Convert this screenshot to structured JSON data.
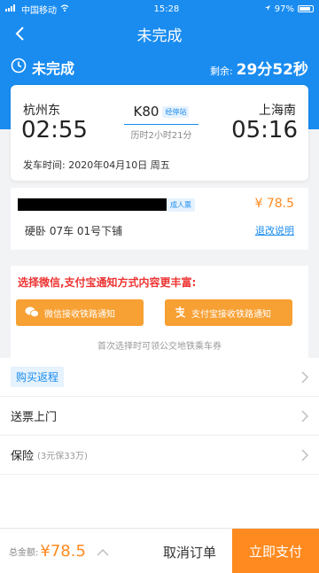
{
  "statusbar": {
    "carrier": "中国移动",
    "time": "15:28",
    "battery": "97%"
  },
  "nav": {
    "title": "未完成"
  },
  "status": {
    "label": "未完成",
    "remaining_label": "剩余:",
    "remaining_value": "29分52秒"
  },
  "trip": {
    "from_station": "杭州东",
    "from_time": "02:55",
    "to_station": "上海南",
    "to_time": "05:16",
    "train_no": "K80",
    "train_tag": "经停站",
    "duration": "历时2小时21分",
    "depart_label": "发车时间:",
    "depart_date": "2020年04月10日 周五"
  },
  "passenger": {
    "tag": "成人票",
    "price": "¥ 78.5",
    "seat": "硬卧 07车 01号下铺",
    "refund_link": "退改说明"
  },
  "notice": {
    "title": "选择微信,支付宝通知方式内容更丰富:",
    "wechat_btn": "微信接收铁路通知",
    "alipay_btn": "支付宝接收铁路通知",
    "footnote": "首次选择时可领公交地铁乘车券"
  },
  "list": {
    "return_ticket": "购买返程",
    "delivery": "送票上门",
    "insurance": "保险",
    "insurance_sub": "(3元保33万)"
  },
  "bottom": {
    "total_label": "总金额:",
    "total_amount": "¥78.5",
    "cancel_label": "取消订单",
    "pay_label": "立即支付"
  },
  "colors": {
    "brand_blue": "#1a8cf0",
    "accent_orange": "#ff8a1f",
    "warning_red": "#e33333"
  }
}
